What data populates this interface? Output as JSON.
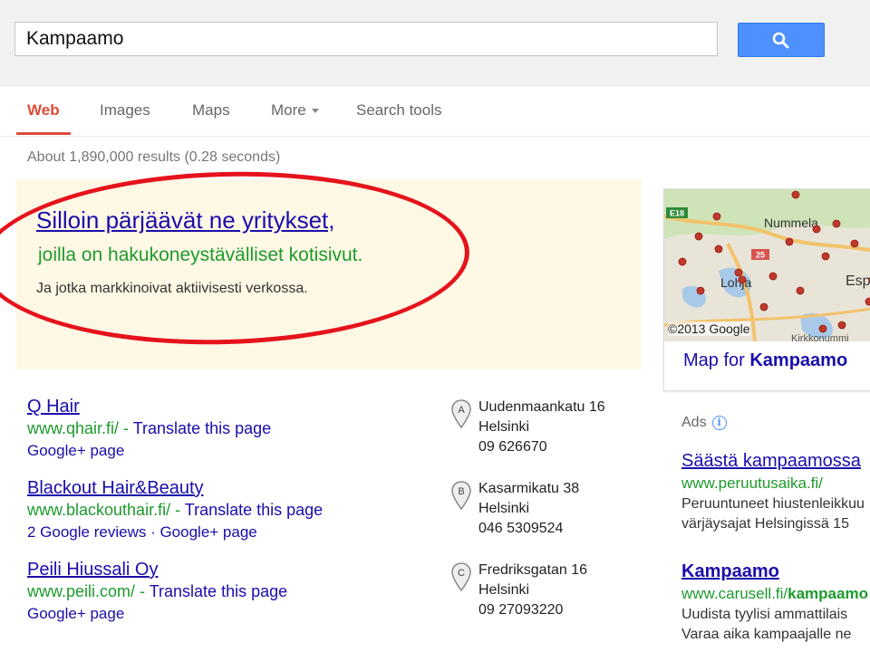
{
  "search": {
    "query": "Kampaamo"
  },
  "tabs": [
    {
      "label": "Web"
    },
    {
      "label": "Images"
    },
    {
      "label": "Maps"
    },
    {
      "label": "More"
    },
    {
      "label": "Search tools"
    }
  ],
  "result_stats": "About 1,890,000 results (0.28 seconds)",
  "ad": {
    "title": "Silloin pärjäävät ne yritykset,",
    "green_line": "joilla on hakukoneystävälliset kotisivut.",
    "description": "Ja jotka markkinoivat aktiivisesti verkossa."
  },
  "results": [
    {
      "title": "Q Hair",
      "url": "www.qhair.fi/",
      "separator": " - ",
      "translate": "Translate this page",
      "meta": "Google+ page",
      "marker": "A",
      "address": [
        "Uudenmaankatu 16",
        "Helsinki",
        "09 626670"
      ]
    },
    {
      "title": "Blackout Hair&Beauty",
      "url": "www.blackouthair.fi/",
      "separator": " - ",
      "translate": "Translate this page",
      "meta": "2 Google reviews · Google+ page",
      "marker": "B",
      "address": [
        "Kasarmikatu 38",
        "Helsinki",
        "046 5309524"
      ]
    },
    {
      "title": "Peili Hiussali Oy",
      "url": "www.peili.com/",
      "separator": " - ",
      "translate": "Translate this page",
      "meta": "Google+ page",
      "marker": "C",
      "address": [
        "Fredriksgatan 16",
        "Helsinki",
        "09 27093220"
      ]
    }
  ],
  "map": {
    "credit": "©2013 Google",
    "labels": [
      "Nummela",
      "Lohja",
      "Esp",
      "E18",
      "25",
      "Kirkkonummi",
      "K"
    ],
    "map_for_prefix": "Map for ",
    "map_for_query": "Kampaamo"
  },
  "side_ads": {
    "label": "Ads",
    "items": [
      {
        "title": "Säästä kampaamossa",
        "url": "www.peruutusaika.fi/",
        "lines": [
          "Peruuntuneet hiustenleikkuu",
          "värjäysajat Helsingissä 15"
        ]
      },
      {
        "title": "Kampaamo",
        "url_prefix": "www.carusell.fi/",
        "url_bold": "kampaamo",
        "lines": [
          "Uudista tyylisi ammattilais",
          "Varaa aika kampaajalle ne"
        ]
      }
    ]
  },
  "colors": {
    "accent_red": "#dd4b39",
    "link_blue": "#1a0dab",
    "url_green": "#1e9a2c",
    "search_button": "#4d90fe",
    "ad_background": "#fff8e5",
    "annotation_red": "#e5131c"
  }
}
